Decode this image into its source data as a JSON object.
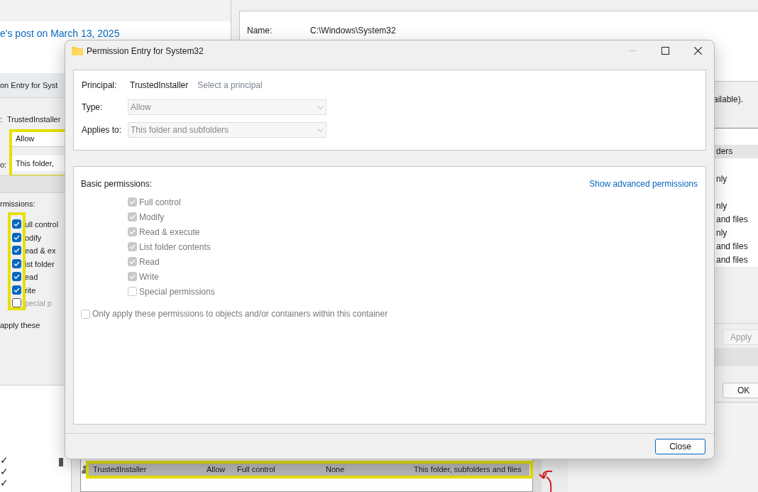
{
  "background_page": {
    "link": "e's post on March 13, 2025",
    "window_fragment": "on Entry for Syst"
  },
  "left_window": {
    "principal_label": ":",
    "principal": "TrustedInstaller",
    "type": "Allow",
    "applies_label": "o:",
    "applies": "This folder,",
    "permissions_label": "rmissions:",
    "permissions": [
      {
        "label": "ull control",
        "checked": true
      },
      {
        "label": "odify",
        "checked": true
      },
      {
        "label": "ead & ex",
        "checked": true
      },
      {
        "label": "ist folder",
        "checked": true
      },
      {
        "label": "ead",
        "checked": true
      },
      {
        "label": "rite",
        "checked": true
      },
      {
        "label": "pecial p",
        "checked": false
      }
    ],
    "only_apply": "apply these",
    "marks": [
      "✓",
      "✓",
      "✓"
    ]
  },
  "right_window": {
    "name_label": "Name:",
    "name_value": "C:\\Windows\\System32",
    "note": "ailable).",
    "list": [
      {
        "text": "ders",
        "selected": true
      },
      {
        "text": "nly",
        "selected": false
      },
      {
        "text": "nly",
        "selected": false
      },
      {
        "text": "and files",
        "selected": false
      },
      {
        "text": "nly",
        "selected": false
      },
      {
        "text": "and files",
        "selected": false
      },
      {
        "text": "and files",
        "selected": false
      }
    ],
    "apply": "Apply",
    "ok": "OK"
  },
  "entry_row": {
    "cells": [
      "TrustedInstaller",
      "Allow",
      "Full control",
      "None",
      "This folder, subfolders and files"
    ]
  },
  "dialog": {
    "title": "Permission Entry for System32",
    "principal_label": "Principal:",
    "principal": "TrustedInstaller",
    "select_link": "Select a principal",
    "type_label": "Type:",
    "type": "Allow",
    "applies_label": "Applies to:",
    "applies": "This folder and subfolders",
    "fields_disabled": true,
    "basic_label": "Basic permissions:",
    "advanced_link": "Show advanced permissions",
    "permissions": [
      {
        "label": "Full control",
        "checked": true,
        "disabled": true
      },
      {
        "label": "Modify",
        "checked": true,
        "disabled": true
      },
      {
        "label": "Read & execute",
        "checked": true,
        "disabled": true
      },
      {
        "label": "List folder contents",
        "checked": true,
        "disabled": true
      },
      {
        "label": "Read",
        "checked": true,
        "disabled": true
      },
      {
        "label": "Write",
        "checked": true,
        "disabled": true
      },
      {
        "label": "Special permissions",
        "checked": false,
        "disabled": true
      }
    ],
    "only_apply": {
      "label": "Only apply these permissions to objects and/or containers within this container",
      "checked": false,
      "disabled": true
    },
    "close": "Close"
  }
}
